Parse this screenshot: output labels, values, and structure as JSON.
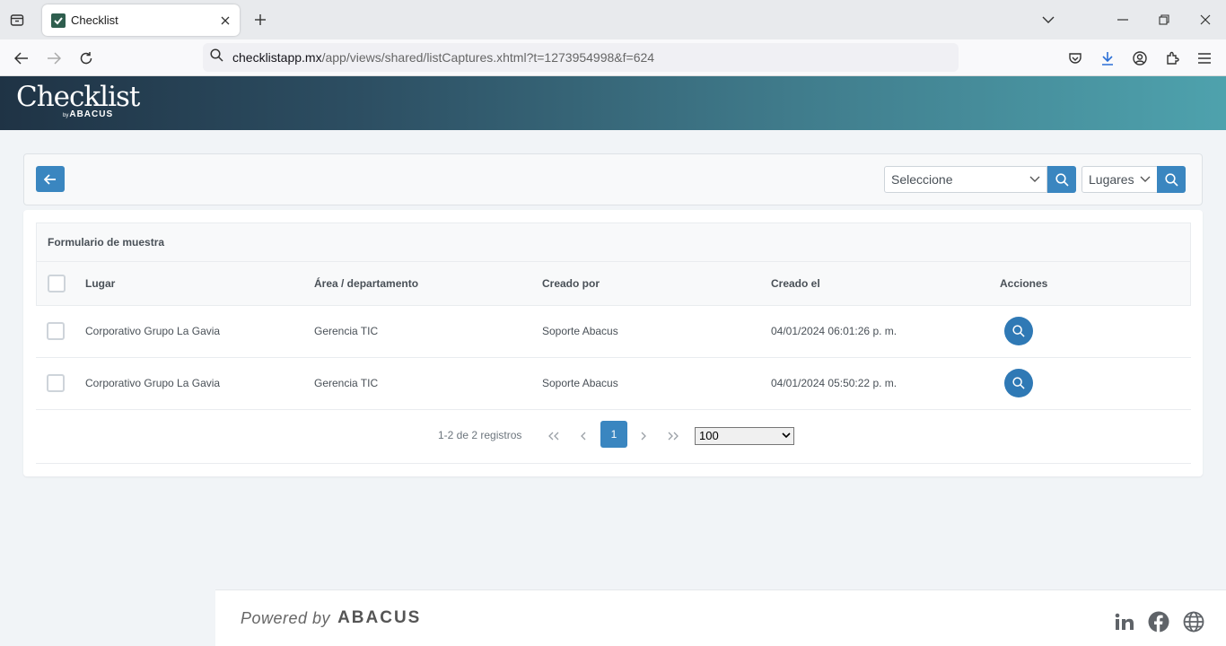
{
  "browser": {
    "tab_title": "Checklist",
    "url_host": "checklistapp.mx",
    "url_path": "/app/views/shared/listCaptures.xhtml?t=1273954998&f=624"
  },
  "header": {
    "logo_text": "Checklist",
    "logo_by": "by",
    "logo_brand": "ABACUS"
  },
  "toolbar": {
    "select_value": "Seleccione",
    "places_value": "Lugares"
  },
  "table": {
    "form_title": "Formulario de muestra",
    "columns": [
      "Lugar",
      "Área / departamento",
      "Creado por",
      "Creado el",
      "Acciones"
    ],
    "rows": [
      {
        "lugar": "Corporativo Grupo La Gavia",
        "area": "Gerencia TIC",
        "creado_por": "Soporte Abacus",
        "creado_el": "04/01/2024 06:01:26 p. m."
      },
      {
        "lugar": "Corporativo Grupo La Gavia",
        "area": "Gerencia TIC",
        "creado_por": "Soporte Abacus",
        "creado_el": "04/01/2024 05:50:22 p. m."
      }
    ]
  },
  "paginator": {
    "report": "1-2 de 2 registros",
    "current_page": "1",
    "rows_per_page": "100"
  },
  "footer": {
    "powered_by": "Powered by",
    "brand": "ABACUS"
  }
}
